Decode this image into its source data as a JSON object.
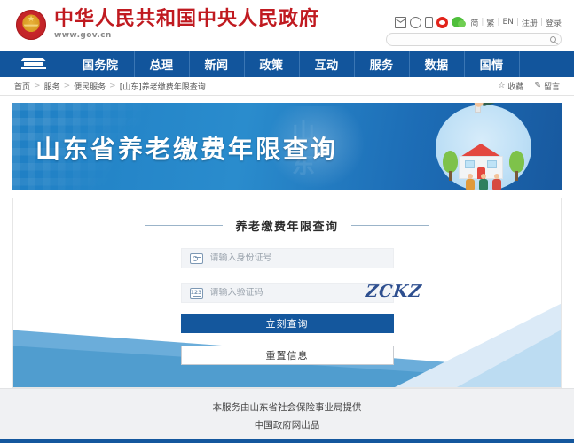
{
  "header": {
    "brand_title": "中华人民共和国中央人民政府",
    "brand_url": "www.gov.cn",
    "emblem_icon": "national-emblem-icon",
    "util_icons": [
      {
        "name": "mail-icon"
      },
      {
        "name": "chat-icon"
      },
      {
        "name": "mobile-icon"
      },
      {
        "name": "weibo-icon"
      },
      {
        "name": "wechat-icon"
      }
    ],
    "links": [
      {
        "label": "简"
      },
      {
        "label": "繁"
      },
      {
        "label": "EN"
      },
      {
        "label": "注册"
      },
      {
        "label": "登录"
      }
    ],
    "separator": "|",
    "search": {
      "value": "",
      "placeholder": "",
      "icon": "search-icon"
    }
  },
  "nav": {
    "home_icon": "tiananmen-home-icon",
    "items": [
      {
        "label": "国务院"
      },
      {
        "label": "总理"
      },
      {
        "label": "新闻"
      },
      {
        "label": "政策"
      },
      {
        "label": "互动"
      },
      {
        "label": "服务"
      },
      {
        "label": "数据"
      },
      {
        "label": "国情"
      }
    ]
  },
  "breadcrumb": {
    "items": [
      {
        "label": "首页"
      },
      {
        "label": "服务"
      },
      {
        "label": "便民服务"
      },
      {
        "label": "[山东]养老缴费年限查询"
      }
    ],
    "separator": ">",
    "favorite_label": "收藏",
    "favorite_icon": "star-icon",
    "message_label": "留言",
    "message_icon": "pencil-icon"
  },
  "banner": {
    "title": "山东省养老缴费年限查询",
    "watermark": "山东",
    "illustration": "family-house-pension-illustration",
    "bg_color": "#2080c6"
  },
  "form": {
    "title": "养老缴费年限查询",
    "id_field": {
      "placeholder": "请输入身份证号",
      "value": "",
      "icon": "id-card-icon"
    },
    "captcha_field": {
      "placeholder": "请输入验证码",
      "value": "",
      "icon": "numbers-icon"
    },
    "captcha_image_text": "ZCKZ",
    "submit_label": "立刻查询",
    "reset_label": "重置信息",
    "primary_color": "#14579d"
  },
  "footer": {
    "line1": "本服务由山东省社会保险事业局提供",
    "line2": "中国政府网出品"
  }
}
